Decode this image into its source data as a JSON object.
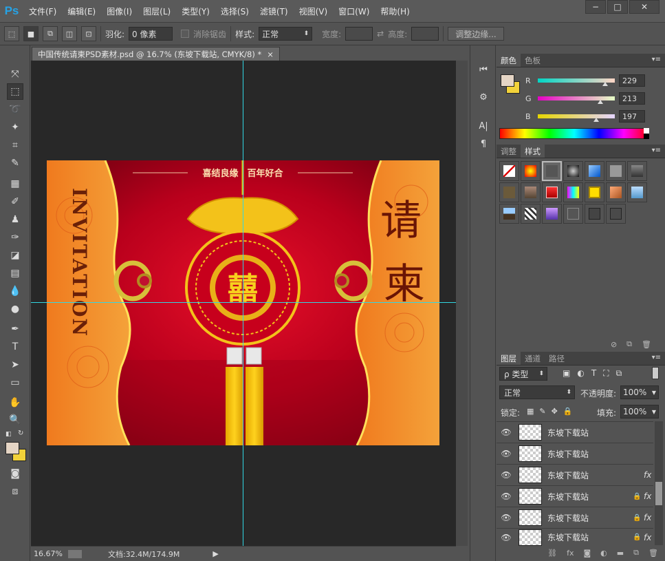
{
  "app": {
    "logo": "Ps"
  },
  "menu": [
    "文件(F)",
    "编辑(E)",
    "图像(I)",
    "图层(L)",
    "类型(Y)",
    "选择(S)",
    "滤镜(T)",
    "视图(V)",
    "窗口(W)",
    "帮助(H)"
  ],
  "window_controls": {
    "minimize": "−",
    "maximize": "□",
    "close": "✕"
  },
  "options": {
    "feather_label": "羽化:",
    "feather_value": "0 像素",
    "antialias_label": "消除锯齿",
    "style_label": "样式:",
    "style_value": "正常",
    "width_label": "宽度:",
    "height_label": "高度:",
    "refine_button": "调整边缘..."
  },
  "document": {
    "tab_title": "中国传统请柬PSD素材.psd @ 16.7% (东坡下载站, CMYK/8) *",
    "tab_close": "×",
    "zoom": "16.67%",
    "doc_size": "文档:32.4M/174.9M"
  },
  "artwork": {
    "banner": "喜结良缘　百年好合",
    "invitation": "INVITATION",
    "title_char1": "请",
    "title_char2": "柬",
    "center_char": "囍"
  },
  "color_panel": {
    "tabs": [
      "颜色",
      "色板"
    ],
    "fg_color": "#e5d5c5",
    "bg_color": "#f2d23a",
    "r_label": "R",
    "r_value": "229",
    "g_label": "G",
    "g_value": "213",
    "b_label": "B",
    "b_value": "197"
  },
  "styles_panel": {
    "tabs": [
      "调整",
      "样式"
    ]
  },
  "layers_panel": {
    "tabs": [
      "图层",
      "通道",
      "路径"
    ],
    "filter_label": "ρ 类型",
    "blend_mode": "正常",
    "opacity_label": "不透明度:",
    "opacity_value": "100%",
    "lock_label": "锁定:",
    "fill_label": "填充:",
    "fill_value": "100%",
    "layers": [
      {
        "name": "东坡下载站",
        "fx": "",
        "lock": ""
      },
      {
        "name": "东坡下载站",
        "fx": "",
        "lock": ""
      },
      {
        "name": "东坡下载站",
        "fx": "fx",
        "lock": ""
      },
      {
        "name": "东坡下载站",
        "fx": "fx",
        "lock": "🔒"
      },
      {
        "name": "东坡下载站",
        "fx": "fx",
        "lock": "🔒"
      },
      {
        "name": "东坡下载站",
        "fx": "fx",
        "lock": "🔒"
      }
    ]
  }
}
